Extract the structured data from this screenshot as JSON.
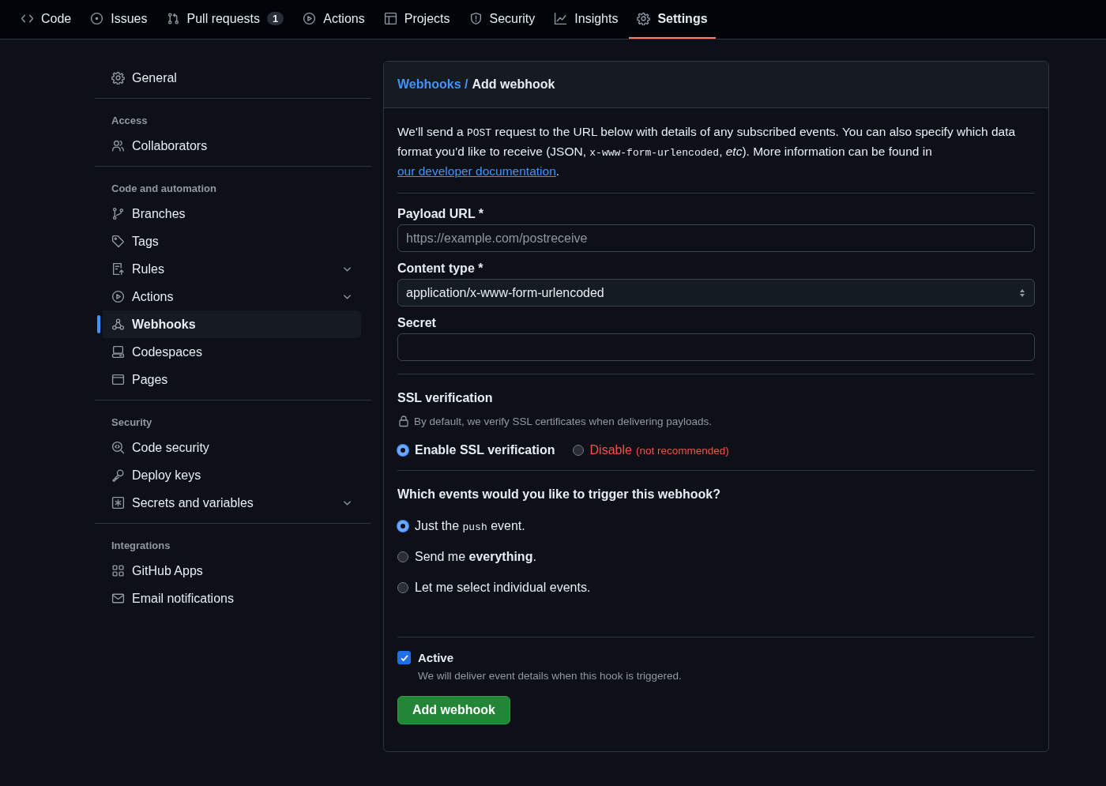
{
  "tabs": [
    {
      "label": "Code",
      "kind": "code",
      "selected": false
    },
    {
      "label": "Issues",
      "kind": "issue",
      "selected": false
    },
    {
      "label": "Pull requests",
      "kind": "pr",
      "counter": "1",
      "selected": false
    },
    {
      "label": "Actions",
      "kind": "play",
      "selected": false
    },
    {
      "label": "Projects",
      "kind": "table",
      "selected": false
    },
    {
      "label": "Security",
      "kind": "shield",
      "selected": false
    },
    {
      "label": "Insights",
      "kind": "graph",
      "selected": false
    },
    {
      "label": "Settings",
      "kind": "gear",
      "selected": true
    }
  ],
  "sidebar": {
    "sections": [
      {
        "items": [
          {
            "label": "General",
            "kind": "gear",
            "expandable": false,
            "selected": false
          }
        ]
      },
      {
        "heading": "Access",
        "items": [
          {
            "label": "Collaborators",
            "kind": "people",
            "expandable": false,
            "selected": false
          }
        ]
      },
      {
        "heading": "Code and automation",
        "items": [
          {
            "label": "Branches",
            "kind": "branch",
            "expandable": false,
            "selected": false
          },
          {
            "label": "Tags",
            "kind": "tag",
            "expandable": false,
            "selected": false
          },
          {
            "label": "Rules",
            "kind": "rules",
            "expandable": true,
            "selected": false
          },
          {
            "label": "Actions",
            "kind": "play",
            "expandable": true,
            "selected": false
          },
          {
            "label": "Webhooks",
            "kind": "webhook",
            "expandable": false,
            "selected": true
          },
          {
            "label": "Codespaces",
            "kind": "codespaces",
            "expandable": false,
            "selected": false
          },
          {
            "label": "Pages",
            "kind": "browser",
            "expandable": false,
            "selected": false
          }
        ]
      },
      {
        "heading": "Security",
        "items": [
          {
            "label": "Code security",
            "kind": "codescan",
            "expandable": false,
            "selected": false
          },
          {
            "label": "Deploy keys",
            "kind": "key",
            "expandable": false,
            "selected": false
          },
          {
            "label": "Secrets and variables",
            "kind": "asterisk",
            "expandable": true,
            "selected": false
          }
        ]
      },
      {
        "heading": "Integrations",
        "items": [
          {
            "label": "GitHub Apps",
            "kind": "apps",
            "expandable": false,
            "selected": false
          },
          {
            "label": "Email notifications",
            "kind": "mail",
            "expandable": false,
            "selected": false
          }
        ]
      }
    ]
  },
  "form": {
    "breadcrumb": {
      "parent": "Webhooks /",
      "current": "Add webhook"
    },
    "description": [
      {
        "kind": "text",
        "text": "We'll send a "
      },
      {
        "kind": "code",
        "text": "POST"
      },
      {
        "kind": "text",
        "text": " request to the URL below with details of any subscribed events. You can also specify which data format you'd like to receive (JSON, "
      },
      {
        "kind": "code",
        "text": "x-www-form-urlencoded"
      },
      {
        "kind": "text",
        "text": ", *etc*). More information can be found in "
      },
      {
        "kind": "link",
        "text": "our developer documentation"
      },
      {
        "kind": "text",
        "text": "."
      }
    ],
    "payload_url": {
      "label": "Payload URL *",
      "placeholder": "https://example.com/postreceive"
    },
    "content_type": {
      "label": "Content type *",
      "value": "application/x-www-form-urlencoded"
    },
    "secret": {
      "label": "Secret"
    },
    "ssl": {
      "heading": "SSL verification",
      "note": "By default, we verify SSL certificates when delivering payloads.",
      "options": [
        {
          "label": "Enable SSL verification",
          "kind": "normal",
          "selected": true
        },
        {
          "label": "Disable",
          "note": "(not recommended)",
          "kind": "danger",
          "selected": false
        }
      ]
    },
    "events": {
      "heading": "Which events would you like to trigger this webhook?",
      "options": [
        {
          "parts": [
            {
              "kind": "text",
              "text": "Just the "
            },
            {
              "kind": "code",
              "text": "push"
            },
            {
              "kind": "text",
              "text": " event."
            }
          ],
          "selected": true
        },
        {
          "parts": [
            {
              "kind": "text",
              "text": "Send me **everything**."
            }
          ],
          "selected": false
        },
        {
          "parts": [
            {
              "kind": "text",
              "text": "Let me select individual events."
            }
          ],
          "selected": false
        }
      ]
    },
    "active": {
      "label": "Active",
      "checked": true,
      "note": "We will deliver event details when this hook is triggered."
    },
    "submit": "Add webhook"
  }
}
